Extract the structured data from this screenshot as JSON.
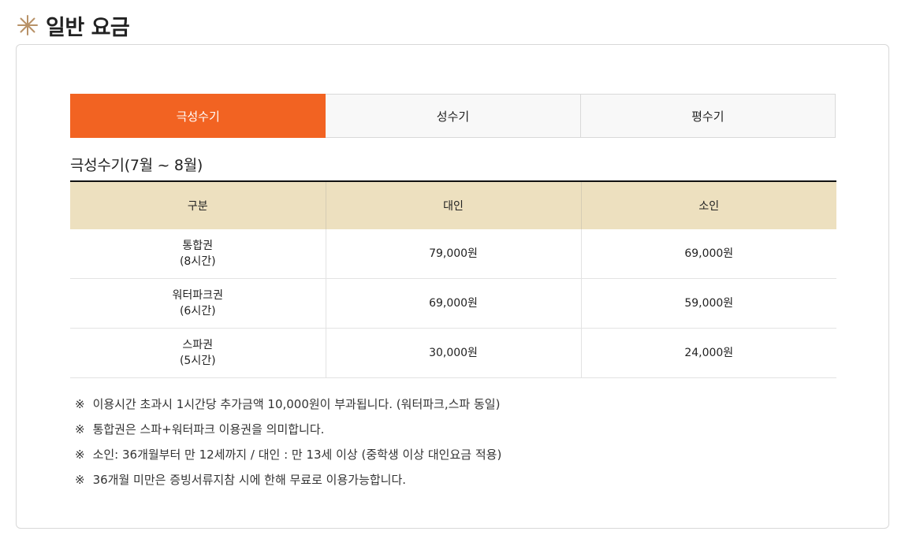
{
  "heading": {
    "title": "일반 요금",
    "icon": "sparkle-star-icon",
    "icon_color": "#b89268"
  },
  "tabs": [
    {
      "label": "극성수기",
      "active": true
    },
    {
      "label": "성수기",
      "active": false
    },
    {
      "label": "평수기",
      "active": false
    }
  ],
  "accent_color": "#f26322",
  "section_title": "극성수기(7월 ~ 8월)",
  "table": {
    "header_bg": "#ede0bf",
    "headers": [
      "구분",
      "대인",
      "소인"
    ],
    "rows": [
      {
        "name": "통합권",
        "duration": "(8시간)",
        "adult": "79,000원",
        "child": "69,000원"
      },
      {
        "name": "워터파크권",
        "duration": "(6시간)",
        "adult": "69,000원",
        "child": "59,000원"
      },
      {
        "name": "스파권",
        "duration": "(5시간)",
        "adult": "30,000원",
        "child": "24,000원"
      }
    ]
  },
  "notes": {
    "mark": "※",
    "items": [
      "이용시간 초과시 1시간당 추가금액 10,000원이 부과됩니다. (워터파크,스파 동일)",
      "통합권은 스파+워터파크 이용권을 의미합니다.",
      "소인: 36개월부터 만 12세까지 / 대인 : 만 13세 이상 (중학생 이상 대인요금 적용)",
      "36개월 미만은 증빙서류지참 시에 한해 무료로 이용가능합니다."
    ]
  }
}
